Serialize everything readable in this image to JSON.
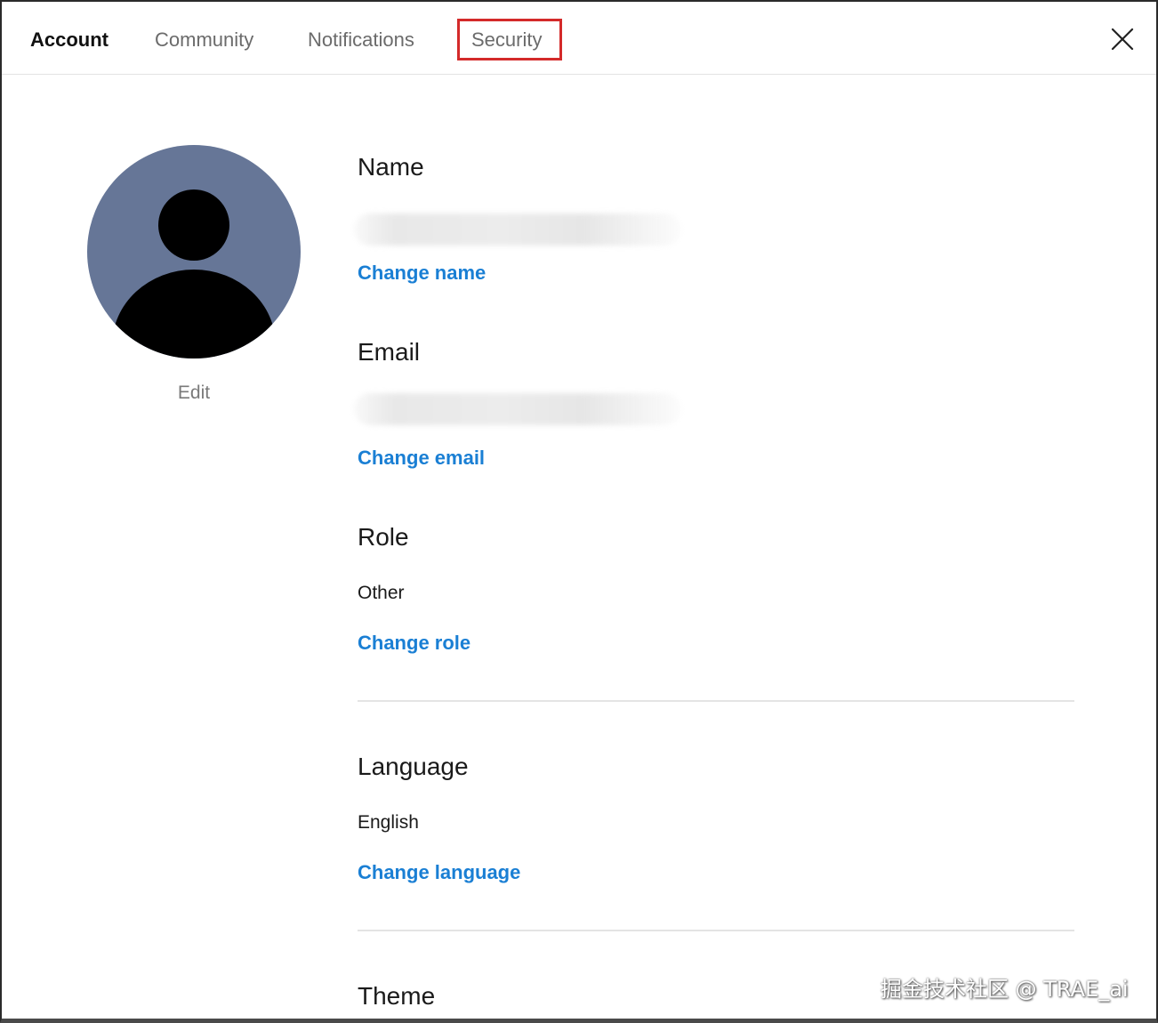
{
  "tabs": [
    {
      "label": "Account",
      "active": true
    },
    {
      "label": "Community",
      "active": false
    },
    {
      "label": "Notifications",
      "active": false
    },
    {
      "label": "Security",
      "active": false,
      "highlighted": true
    }
  ],
  "close_icon": "close-icon",
  "avatar": {
    "edit_label": "Edit",
    "background": "#667697"
  },
  "sections": {
    "name": {
      "title": "Name",
      "action": "Change name"
    },
    "email": {
      "title": "Email",
      "action": "Change email"
    },
    "role": {
      "title": "Role",
      "value": "Other",
      "action": "Change role"
    },
    "language": {
      "title": "Language",
      "value": "English",
      "action": "Change language"
    },
    "theme": {
      "title": "Theme"
    }
  },
  "colors": {
    "link": "#1a7fd4",
    "highlight": "#d42a2a"
  },
  "watermark": "掘金技术社区 @ TRAE_ai"
}
